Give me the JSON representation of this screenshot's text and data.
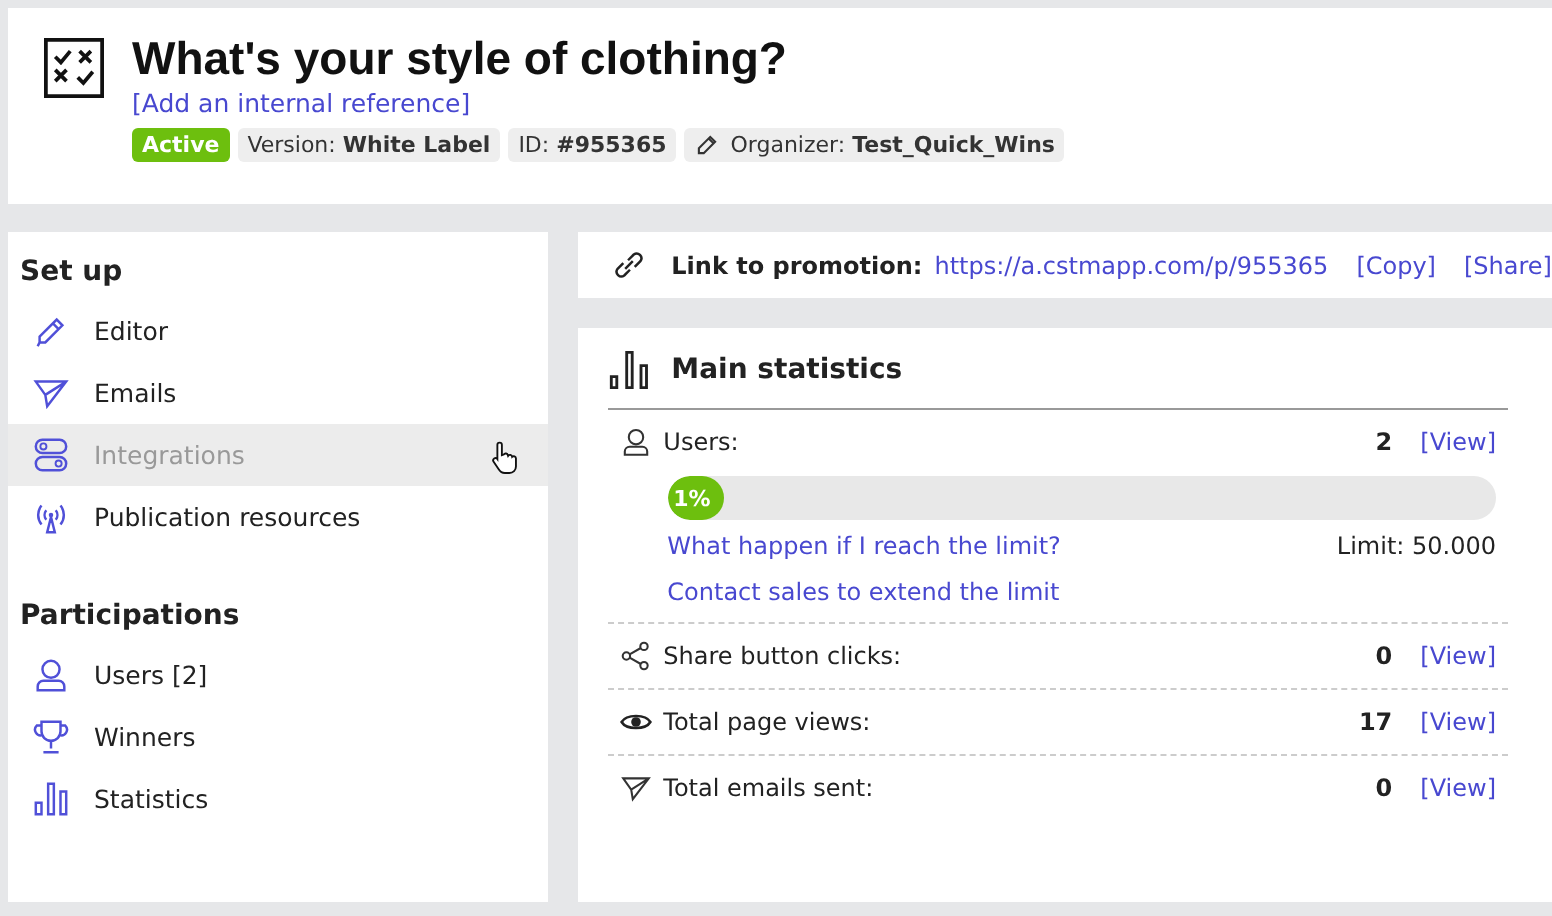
{
  "header": {
    "title": "What's your style of clothing?",
    "reference_link": "[Add an internal reference]",
    "tags": [
      {
        "kind": "status",
        "value": "Active"
      },
      {
        "kind": "pair",
        "label": "Version:",
        "value": "White Label"
      },
      {
        "kind": "pair",
        "label": "ID:",
        "value": "#955365"
      },
      {
        "kind": "organizer",
        "label": "Organizer:",
        "value": "Test_Quick_Wins"
      }
    ]
  },
  "sidebar": {
    "sections": [
      {
        "title": "Set up",
        "items": [
          {
            "label": "Editor",
            "kind": "pencil",
            "hovered": false
          },
          {
            "label": "Emails",
            "kind": "plane",
            "hovered": false
          },
          {
            "label": "Integrations",
            "kind": "toggles",
            "hovered": true
          },
          {
            "label": "Publication resources",
            "kind": "antenna",
            "hovered": false
          }
        ]
      },
      {
        "title": "Participations",
        "items": [
          {
            "label": "Users [2]",
            "kind": "user",
            "hovered": false
          },
          {
            "label": "Winners",
            "kind": "trophy",
            "hovered": false
          },
          {
            "label": "Statistics",
            "kind": "bars",
            "hovered": false
          }
        ]
      }
    ]
  },
  "promotion": {
    "label": "Link to promotion:",
    "url": "https://a.cstmapp.com/p/955365",
    "actions": [
      "[Copy]",
      "[Share]"
    ]
  },
  "statistics": {
    "title": "Main statistics",
    "rows": [
      {
        "kind": "user",
        "label": "Users:",
        "value": "2",
        "link": "[View]",
        "progress": {
          "level": 0.01,
          "text": "1%"
        },
        "limit_link": "What happen if I reach the limit?",
        "limit": "Limit: 50.000",
        "sales_link": "Contact sales to extend the limit"
      },
      {
        "kind": "share",
        "label": "Share button clicks:",
        "value": "0",
        "link": "[View]"
      },
      {
        "kind": "eye",
        "label": "Total page views:",
        "value": "17",
        "link": "[View]"
      },
      {
        "kind": "plane",
        "label": "Total emails sent:",
        "value": "0",
        "link": "[View]"
      }
    ]
  }
}
